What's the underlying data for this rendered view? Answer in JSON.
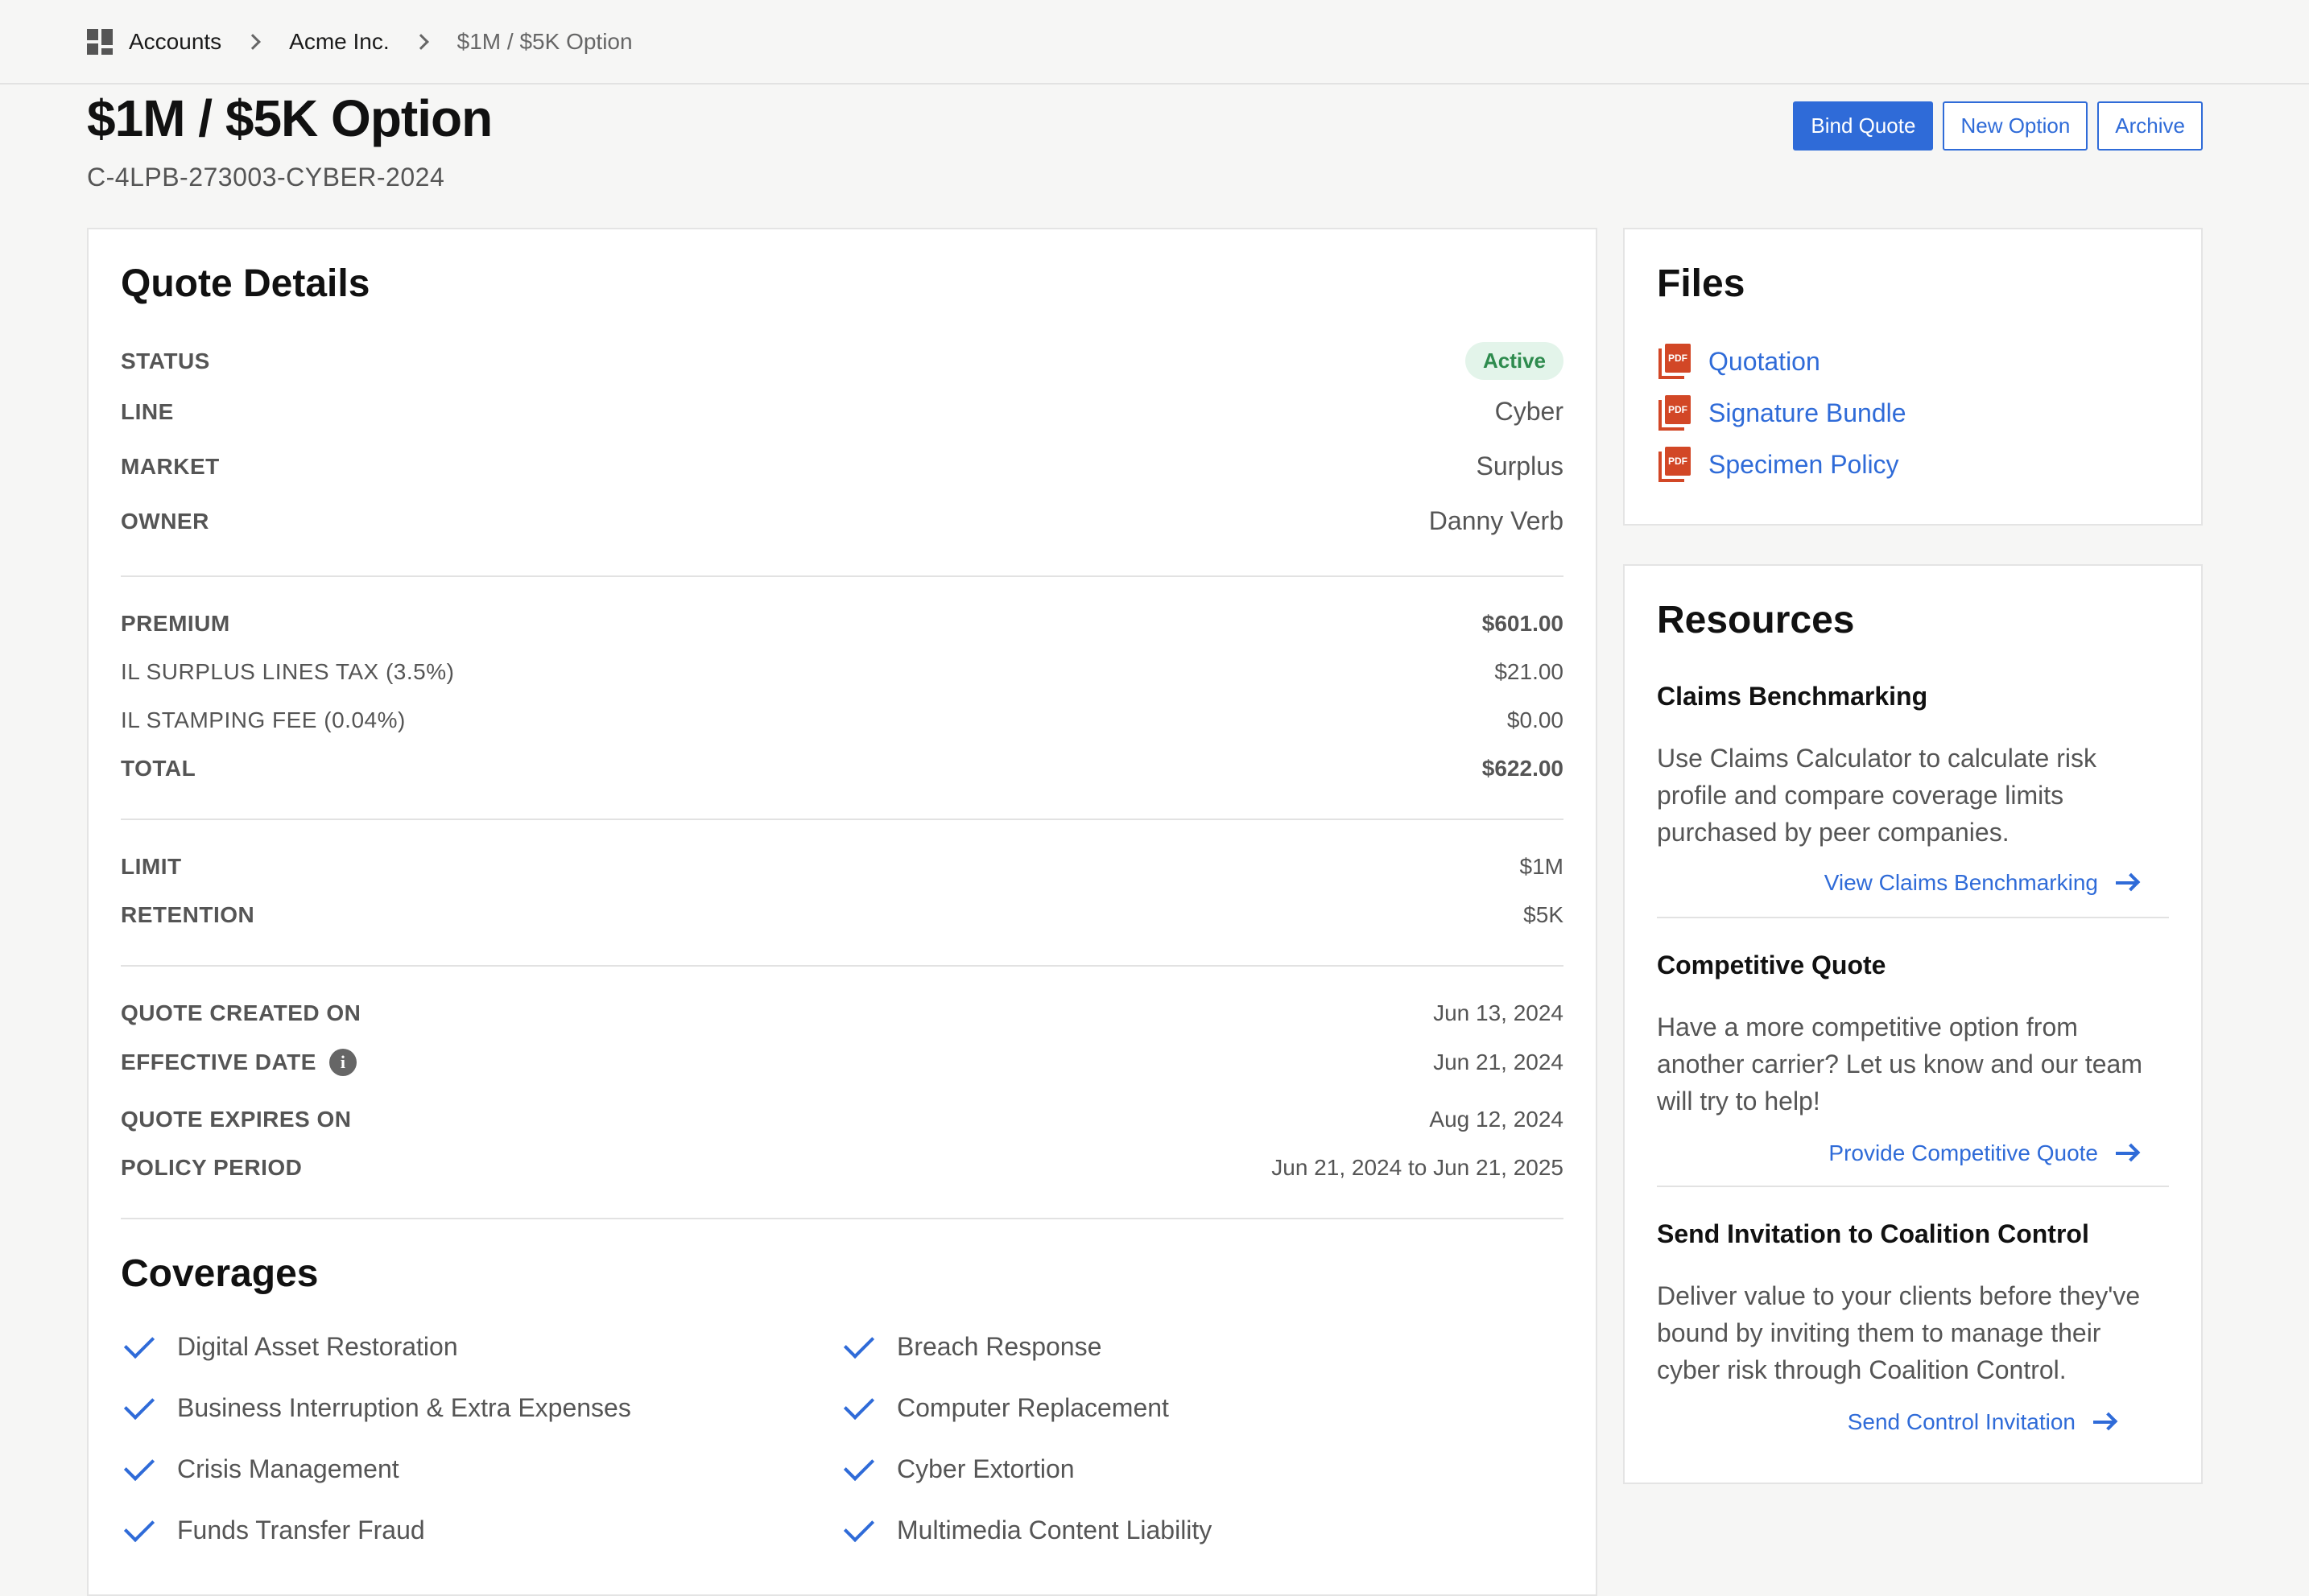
{
  "breadcrumb": {
    "items": [
      "Accounts",
      "Acme Inc.",
      "$1M / $5K Option"
    ]
  },
  "header": {
    "title": "$1M / $5K Option",
    "subtitle": "C-4LPB-273003-CYBER-2024",
    "buttons": {
      "bind": "Bind Quote",
      "new_option": "New Option",
      "archive": "Archive"
    }
  },
  "quote": {
    "title": "Quote Details",
    "status_label": "STATUS",
    "status_value": "Active",
    "line_label": "LINE",
    "line_value": "Cyber",
    "market_label": "MARKET",
    "market_value": "Surplus",
    "owner_label": "OWNER",
    "owner_value": "Danny Verb",
    "premium_label": "PREMIUM",
    "premium_value": "$601.00",
    "tax_label": "IL SURPLUS LINES TAX (3.5%)",
    "tax_value": "$21.00",
    "fee_label": "IL STAMPING FEE (0.04%)",
    "fee_value": "$0.00",
    "total_label": "TOTAL",
    "total_value": "$622.00",
    "limit_label": "LIMIT",
    "limit_value": "$1M",
    "retention_label": "RETENTION",
    "retention_value": "$5K",
    "created_label": "QUOTE CREATED ON",
    "created_value": "Jun 13, 2024",
    "effective_label": "EFFECTIVE DATE",
    "effective_value": "Jun 21, 2024",
    "expires_label": "QUOTE EXPIRES ON",
    "expires_value": "Aug 12, 2024",
    "period_label": "POLICY PERIOD",
    "period_value": "Jun 21, 2024 to Jun 21, 2025"
  },
  "coverages": {
    "title": "Coverages",
    "left": [
      "Digital Asset Restoration",
      "Business Interruption & Extra Expenses",
      "Crisis Management",
      "Funds Transfer Fraud"
    ],
    "right": [
      "Breach Response",
      "Computer Replacement",
      "Cyber Extortion",
      "Multimedia Content Liability"
    ]
  },
  "files": {
    "title": "Files",
    "items": [
      "Quotation",
      "Signature Bundle",
      "Specimen Policy"
    ],
    "icon_text": "PDF"
  },
  "resources": {
    "title": "Resources",
    "items": [
      {
        "heading": "Claims Benchmarking",
        "body": "Use Claims Calculator to calculate risk profile and compare coverage limits purchased by peer companies.",
        "link": "View Claims Benchmarking"
      },
      {
        "heading": "Competitive Quote",
        "body": "Have a more competitive option from another carrier? Let us know and our team will try to help!",
        "link": "Provide Competitive Quote"
      },
      {
        "heading": "Send Invitation to Coalition Control",
        "body": "Deliver value to your clients before they've bound by inviting them to manage their cyber risk through Coalition Control.",
        "link": "Send Control Invitation"
      }
    ]
  },
  "colors": {
    "accent": "#2f6bd8",
    "success": "#2e8b4e",
    "pdf": "#d24726"
  }
}
